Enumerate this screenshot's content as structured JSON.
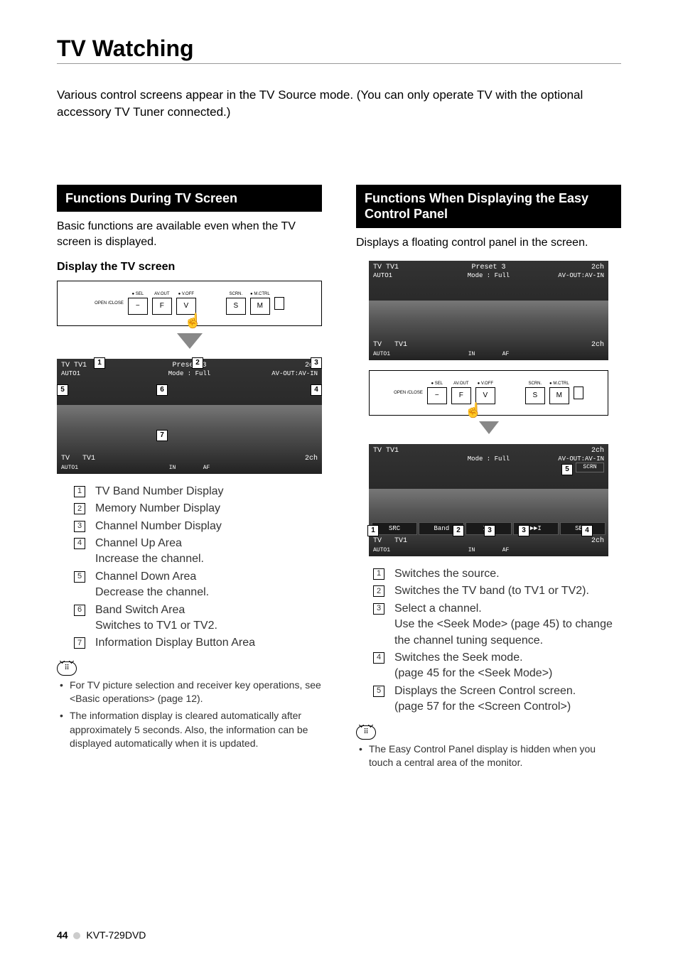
{
  "page": {
    "title": "TV Watching",
    "intro": "Various control screens appear in the TV Source mode. (You can only operate TV with the optional accessory TV Tuner connected.)"
  },
  "panel_labels": {
    "open_close": "OPEN\n/CLOSE",
    "sel": "● SEL",
    "minus": "−",
    "av_out": "AV.OUT",
    "f": "F",
    "v_off": "● V.OFF",
    "v": "V",
    "scrn": "SCRN.",
    "s": "S",
    "m_ctrl": "● M.CTRL",
    "m": "M"
  },
  "left": {
    "header": "Functions During TV Screen",
    "lead": "Basic functions are available even when the TV screen is displayed.",
    "subhead": "Display the TV screen",
    "screen": {
      "tv_band": "TV TV1",
      "auto": "AUTO1",
      "preset": "Preset 3",
      "ch": "2ch",
      "mode": "Mode : Full",
      "avout": "AV-OUT:AV-IN",
      "bot_tv": "TV",
      "bot_tv1": "TV1",
      "bot_2ch": "2ch",
      "in": "IN",
      "af": "AF"
    },
    "items": [
      {
        "n": "1",
        "t": "TV Band Number Display"
      },
      {
        "n": "2",
        "t": "Memory Number Display"
      },
      {
        "n": "3",
        "t": "Channel Number Display"
      },
      {
        "n": "4",
        "t": "Channel Up Area",
        "s": "Increase the channel."
      },
      {
        "n": "5",
        "t": "Channel Down Area",
        "s": "Decrease the channel."
      },
      {
        "n": "6",
        "t": "Band Switch Area",
        "s": "Switches to TV1 or TV2."
      },
      {
        "n": "7",
        "t": "Information Display Button Area"
      }
    ],
    "notes": [
      "For TV picture selection and receiver key operations, see <Basic operations> (page 12).",
      "The information display is cleared automatically after approximately 5 seconds. Also, the information can be displayed automatically when it is updated."
    ]
  },
  "right": {
    "header": "Functions When Displaying the Easy Control Panel",
    "lead": "Displays a floating control panel in the screen.",
    "screen2": {
      "tv_band": "TV TV1",
      "ch": "2ch",
      "mode": "Mode : Full",
      "avout": "AV-OUT:AV-IN",
      "scrn_btn": "SCRN",
      "src_btn": "SRC",
      "band_btn": "Band",
      "prev": "I◄◄",
      "next": "►►I",
      "seek": "SEEK",
      "bot_tv": "TV",
      "bot_tv1": "TV1",
      "bot_2ch": "2ch",
      "auto": "AUTO1",
      "in": "IN",
      "af": "AF"
    },
    "items": [
      {
        "n": "1",
        "t": "Switches the source."
      },
      {
        "n": "2",
        "t": "Switches the TV band (to TV1 or TV2)."
      },
      {
        "n": "3",
        "t": "Select a channel.",
        "s": "Use the <Seek Mode> (page 45) to change the channel tuning sequence."
      },
      {
        "n": "4",
        "t": "Switches the Seek mode.",
        "s": "(page 45 for the <Seek Mode>)"
      },
      {
        "n": "5",
        "t": "Displays the Screen Control screen.",
        "s": "(page 57 for the <Screen Control>)"
      }
    ],
    "notes": [
      "The Easy Control Panel display is hidden when you touch a central area of the monitor."
    ]
  },
  "footer": {
    "page_number": "44",
    "model": "KVT-729DVD"
  }
}
